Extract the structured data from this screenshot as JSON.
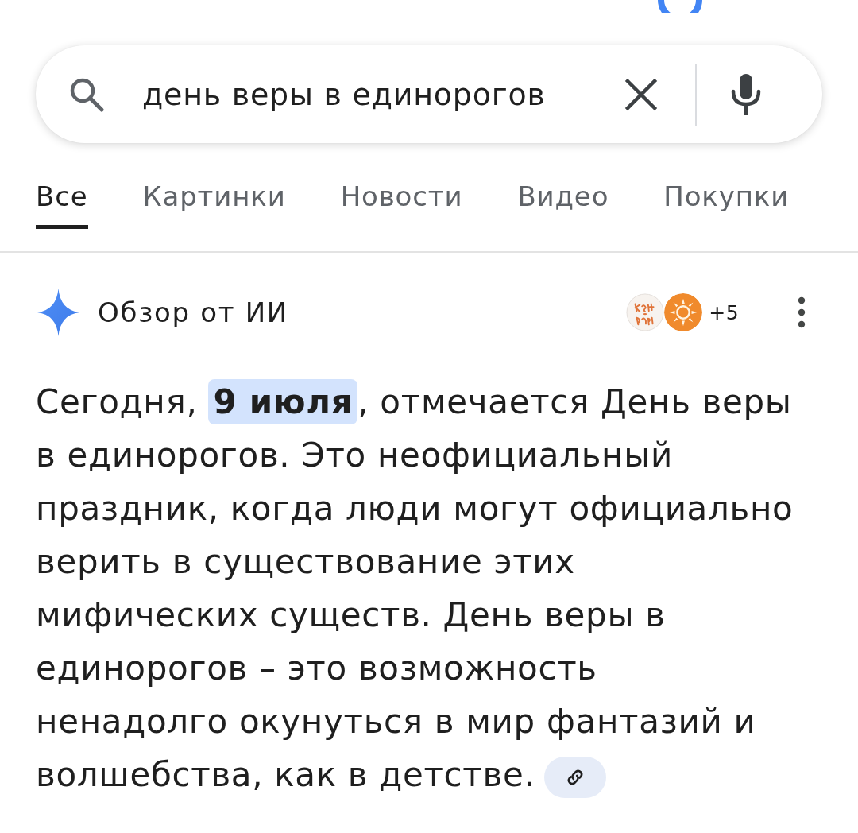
{
  "search": {
    "value": "день веры в единорогов"
  },
  "tabs": [
    {
      "label": "Все",
      "selected": true
    },
    {
      "label": "Картинки",
      "selected": false
    },
    {
      "label": "Новости",
      "selected": false
    },
    {
      "label": "Видео",
      "selected": false
    },
    {
      "label": "Покупки",
      "selected": false
    }
  ],
  "ai_overview": {
    "title": "Обзор от ИИ",
    "more_sources": "+5",
    "text": "Сегодня, **9 июля**, отмечается День веры в единорогов. Это неофициальный праздник, когда люди могут официально верить в существование этих мифических существ. День веры в единорогов – это возможность ненадолго окунуться в мир фантазий и волшебства, как в детстве."
  }
}
